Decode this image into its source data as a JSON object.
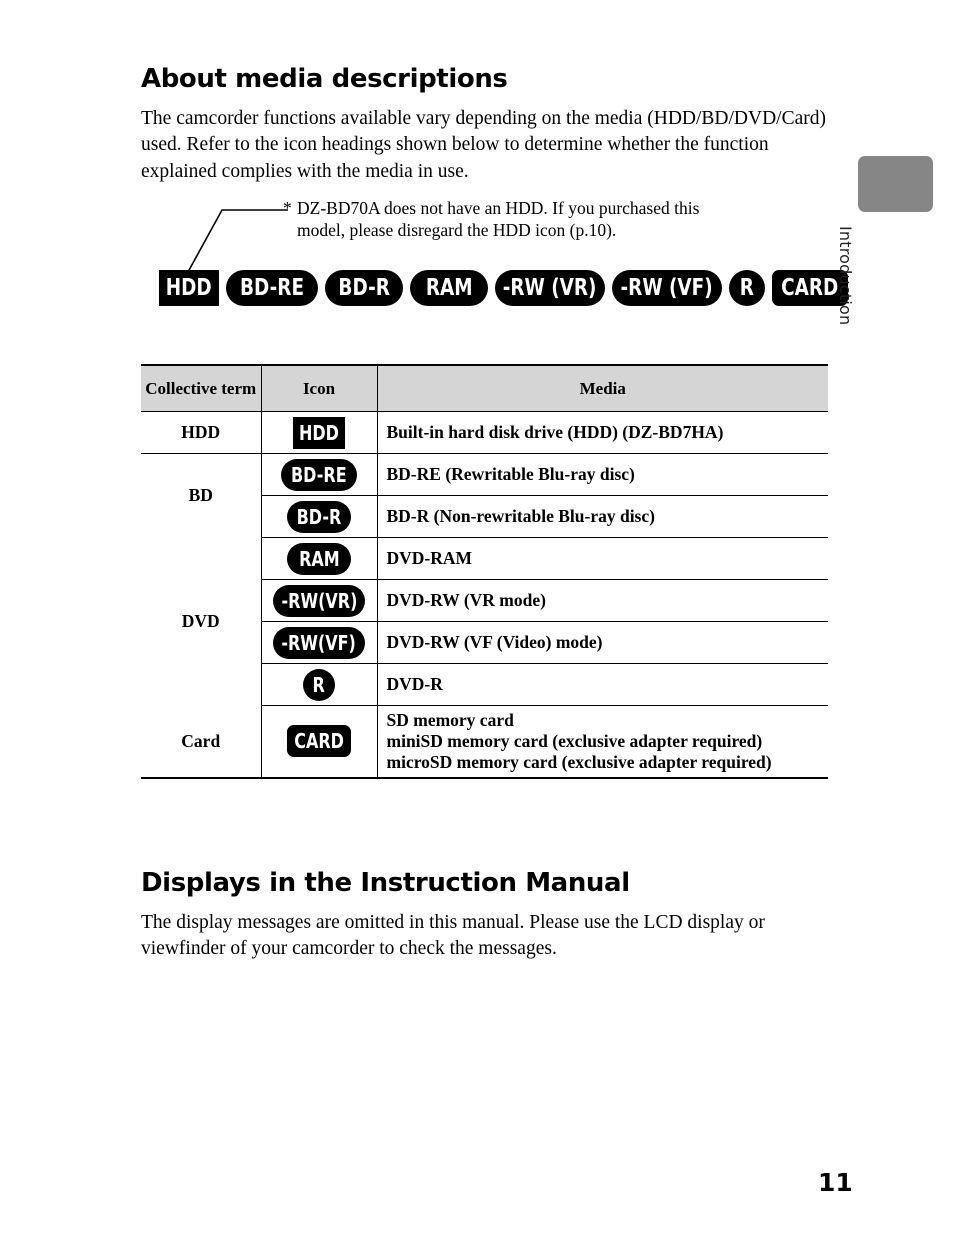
{
  "page": {
    "number": "11",
    "side_tab_label": "Introduction"
  },
  "sections": [
    {
      "heading": "About media descriptions",
      "body": "The camcorder functions available vary depending on the media (HDD/BD/DVD/Card) used. Refer to the icon headings shown below to determine whether the function explained complies with the media in use."
    },
    {
      "heading": "Displays in the Instruction Manual",
      "body": "The display messages are omitted in this manual. Please use the LCD display or viewfinder of your camcorder to check the messages."
    }
  ],
  "footnote": {
    "marker": "*",
    "text": "DZ-BD70A does not have an HDD. If you purchased this model, please disregard the HDD icon (p.10)."
  },
  "icon_strip": [
    {
      "label": "HDD",
      "shape": "rect"
    },
    {
      "label": "BD-RE",
      "shape": "pill"
    },
    {
      "label": "BD-R",
      "shape": "pill"
    },
    {
      "label": "RAM",
      "shape": "pill"
    },
    {
      "label": "-RW (VR)",
      "shape": "pill"
    },
    {
      "label": "-RW (VF)",
      "shape": "pill"
    },
    {
      "label": "R",
      "shape": "circle"
    },
    {
      "label": "CARD",
      "shape": "round-rect"
    }
  ],
  "table": {
    "headers": {
      "term": "Collective term",
      "icon": "Icon",
      "media": "Media"
    },
    "rows": [
      {
        "term": "HDD",
        "icon": "HDD",
        "icon_shape": "rect",
        "media": [
          "Built-in hard disk drive (HDD) (DZ-BD7HA)"
        ]
      },
      {
        "term": "BD",
        "icon": "BD-RE",
        "icon_shape": "pill",
        "media": [
          "BD-RE (Rewritable Blu-ray disc)"
        ]
      },
      {
        "term": "",
        "icon": "BD-R",
        "icon_shape": "pill",
        "media": [
          "BD-R (Non-rewritable Blu-ray disc)"
        ]
      },
      {
        "term": "",
        "icon": "RAM",
        "icon_shape": "pill",
        "media": [
          "DVD-RAM"
        ]
      },
      {
        "term": "DVD",
        "icon": "-RW(VR)",
        "icon_shape": "pill",
        "media": [
          "DVD-RW (VR mode)"
        ]
      },
      {
        "term": "",
        "icon": "-RW(VF)",
        "icon_shape": "pill",
        "media": [
          "DVD-RW (VF (Video) mode)"
        ]
      },
      {
        "term": "",
        "icon": "R",
        "icon_shape": "circle",
        "media": [
          "DVD-R"
        ]
      },
      {
        "term": "Card",
        "icon": "CARD",
        "icon_shape": "round-rect",
        "media": [
          "SD memory card",
          "miniSD memory card (exclusive adapter required)",
          "microSD memory card (exclusive adapter required)"
        ]
      }
    ]
  },
  "colors": {
    "table_header_fill": "#d5d5d5",
    "side_tab_fill": "#868686",
    "icon_fill": "#000000",
    "icon_text": "#ffffff"
  }
}
